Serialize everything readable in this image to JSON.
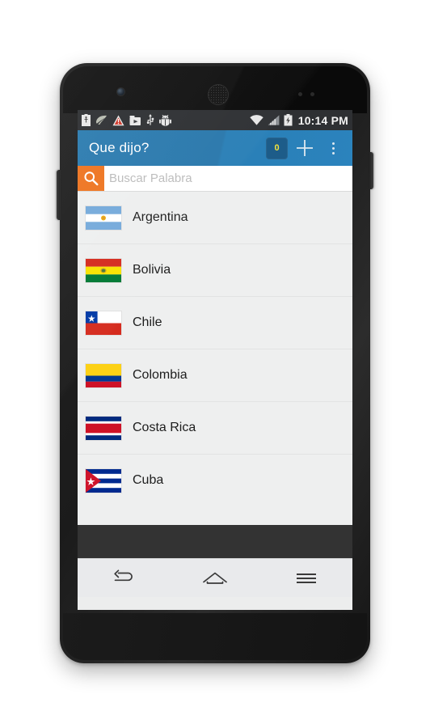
{
  "status_bar": {
    "icons_left": [
      "battery-usb-icon",
      "leaf-icon",
      "warning-triangle-icon",
      "screen-capture-icon",
      "usb-icon",
      "android-debug-icon"
    ],
    "icons_right": [
      "wifi-icon",
      "cellular-signal-icon",
      "battery-charging-icon"
    ],
    "clock": "10:14 PM"
  },
  "action_bar": {
    "title": "Que dijo?",
    "badge_count": "0",
    "add_icon": "plus-icon",
    "overflow_icon": "overflow-menu-icon",
    "background_color": "#2a7cb3",
    "badge_color": "#1d5c89",
    "badge_text_color": "#f2e23c"
  },
  "search": {
    "placeholder": "Buscar Palabra",
    "value": "",
    "icon": "search-icon",
    "button_color": "#ee7521"
  },
  "list": {
    "items": [
      {
        "name": "Argentina",
        "flag": "flag-argentina"
      },
      {
        "name": "Bolivia",
        "flag": "flag-bolivia"
      },
      {
        "name": "Chile",
        "flag": "flag-chile"
      },
      {
        "name": "Colombia",
        "flag": "flag-colombia"
      },
      {
        "name": "Costa Rica",
        "flag": "flag-costa-rica"
      },
      {
        "name": "Cuba",
        "flag": "flag-cuba"
      }
    ]
  },
  "nav_bar": {
    "back_icon": "back-arrow-icon",
    "home_icon": "home-icon",
    "recents_icon": "recent-apps-icon"
  },
  "device": {
    "camera": "front-camera-icon",
    "speaker": "earpiece-speaker-icon",
    "sensors": "proximity-sensor-icon",
    "volume": "volume-rocker-button",
    "power": "power-button"
  }
}
